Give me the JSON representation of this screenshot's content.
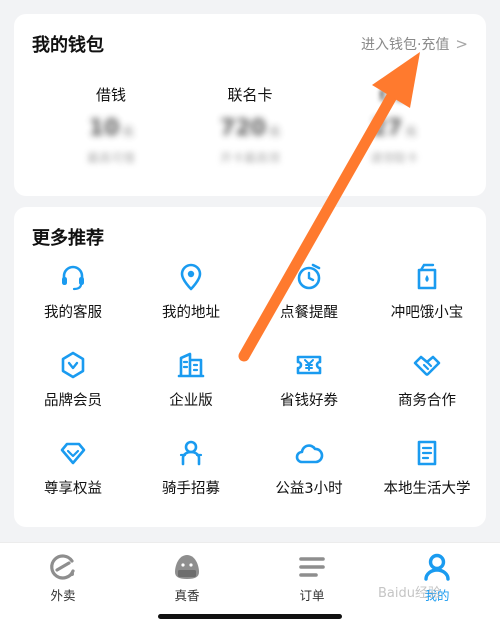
{
  "wallet": {
    "title": "我的钱包",
    "link_label": "进入钱包·充值",
    "link_chevron": ">",
    "stats": [
      {
        "label": "借钱",
        "value": "10",
        "unit": "元",
        "sub": "最高可借"
      },
      {
        "label": "联名卡",
        "value": "720",
        "unit": "元",
        "sub": "开卡最高领"
      },
      {
        "label": "红包",
        "value": "27",
        "unit": "元",
        "sub": "请领取卡"
      }
    ]
  },
  "more": {
    "title": "更多推荐",
    "items": [
      {
        "label": "我的客服",
        "icon": "headset-icon"
      },
      {
        "label": "我的地址",
        "icon": "location-pin-icon"
      },
      {
        "label": "点餐提醒",
        "icon": "alarm-clock-icon"
      },
      {
        "label": "冲吧饿小宝",
        "icon": "cup-icon"
      },
      {
        "label": "品牌会员",
        "icon": "shield-badge-icon"
      },
      {
        "label": "企业版",
        "icon": "building-icon"
      },
      {
        "label": "省钱好券",
        "icon": "coupon-icon"
      },
      {
        "label": "商务合作",
        "icon": "handshake-icon"
      },
      {
        "label": "尊享权益",
        "icon": "diamond-icon"
      },
      {
        "label": "骑手招募",
        "icon": "rider-icon"
      },
      {
        "label": "公益3小时",
        "icon": "cloud-icon"
      },
      {
        "label": "本地生活大学",
        "icon": "book-icon"
      }
    ]
  },
  "tabbar": {
    "tabs": [
      {
        "label": "外卖",
        "icon": "eleme-logo-icon",
        "active": false
      },
      {
        "label": "真香",
        "icon": "rice-ball-icon",
        "active": false
      },
      {
        "label": "订单",
        "icon": "list-icon",
        "active": false
      },
      {
        "label": "我的",
        "icon": "user-icon",
        "active": true
      }
    ]
  },
  "watermark": "Baidu经验",
  "colors": {
    "accent": "#1a9bf0",
    "arrow": "#ff7a2e",
    "background": "#f2f3f5"
  }
}
